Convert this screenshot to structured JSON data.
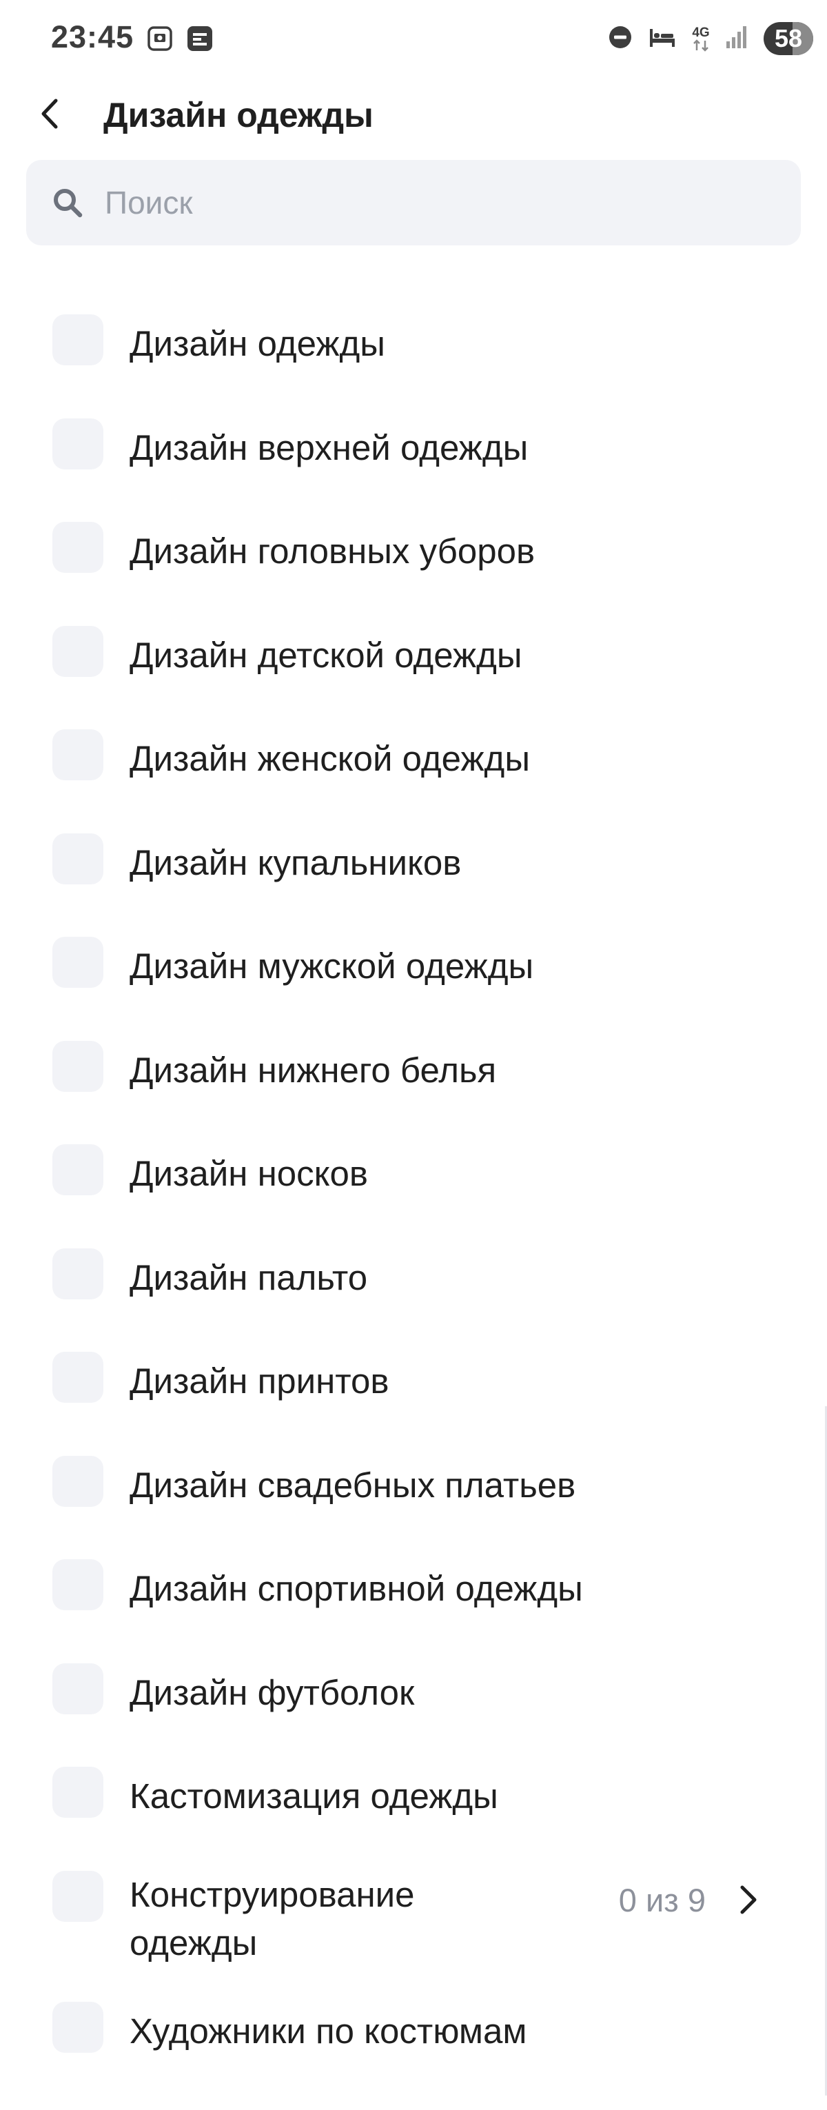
{
  "status_bar": {
    "time": "23:45",
    "battery": "58",
    "network": "4G",
    "icons": [
      "screenshot-icon",
      "notification-icon",
      "dnd-icon",
      "bed-icon",
      "network-4g-icon",
      "signal-icon",
      "battery-icon"
    ]
  },
  "header": {
    "title": "Дизайн одежды",
    "back_icon": "back-arrow-icon"
  },
  "search": {
    "placeholder": "Поиск",
    "value": ""
  },
  "list": {
    "items": [
      {
        "label": "Дизайн одежды",
        "checked": false
      },
      {
        "label": "Дизайн верхней одежды",
        "checked": false
      },
      {
        "label": "Дизайн головных уборов",
        "checked": false
      },
      {
        "label": "Дизайн детской одежды",
        "checked": false
      },
      {
        "label": "Дизайн женской одежды",
        "checked": false
      },
      {
        "label": "Дизайн купальников",
        "checked": false
      },
      {
        "label": "Дизайн мужской одежды",
        "checked": false
      },
      {
        "label": "Дизайн нижнего белья",
        "checked": false
      },
      {
        "label": "Дизайн носков",
        "checked": false
      },
      {
        "label": "Дизайн пальто",
        "checked": false
      },
      {
        "label": "Дизайн принтов",
        "checked": false
      },
      {
        "label": "Дизайн свадебных платьев",
        "checked": false
      },
      {
        "label": "Дизайн спортивной одежды",
        "checked": false
      },
      {
        "label": "Дизайн футболок",
        "checked": false
      },
      {
        "label": "Кастомизация одежды",
        "checked": false
      },
      {
        "label": "Конструирование одежды",
        "checked": false,
        "count": "0 из 9",
        "has_children": true
      },
      {
        "label": "Художники по костюмам",
        "checked": false
      }
    ]
  },
  "colors": {
    "checkbox_bg": "#f2f3f7",
    "search_bg": "#f2f3f7",
    "text_primary": "#1f1f1f",
    "text_secondary": "#8d919b",
    "placeholder": "#9ba0aa"
  }
}
